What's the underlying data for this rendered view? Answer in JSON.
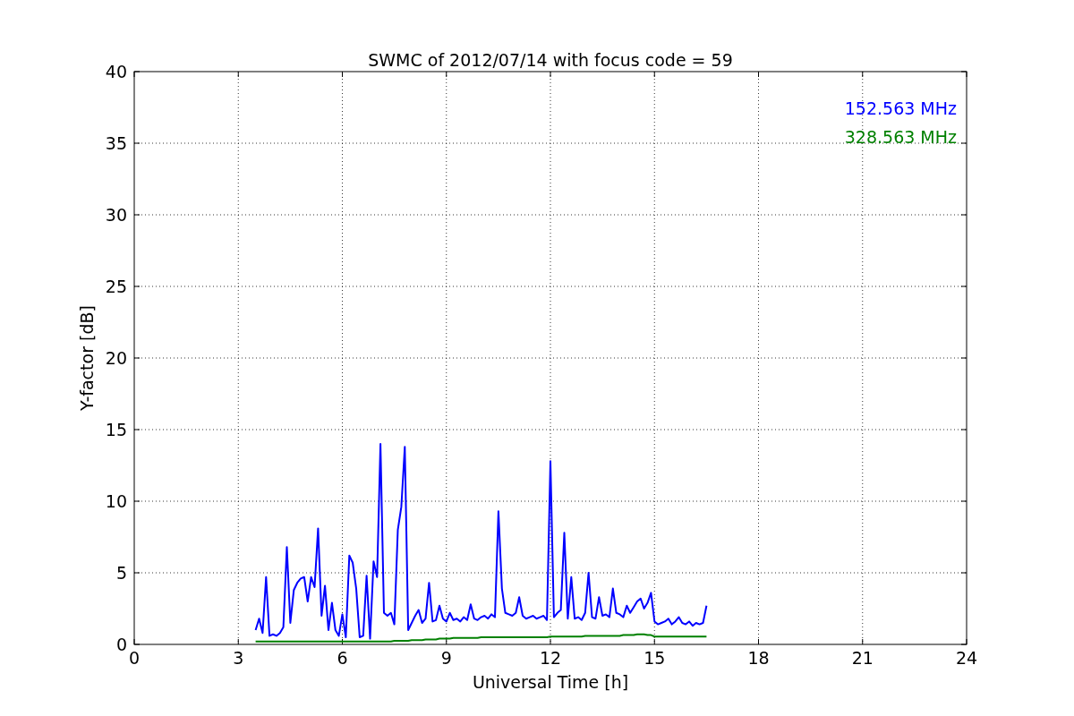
{
  "figure": {
    "chart_data": {
      "type": "line",
      "title": "SWMC of 2012/07/14 with focus code = 59",
      "xlabel": "Universal Time [h]",
      "ylabel": "Y-factor [dB]",
      "xlim": [
        0,
        24
      ],
      "ylim": [
        0,
        40
      ],
      "grid": true,
      "xticks": [
        0,
        3,
        6,
        9,
        12,
        15,
        18,
        21,
        24
      ],
      "yticks": [
        0,
        5,
        10,
        15,
        20,
        25,
        30,
        35,
        40
      ],
      "x": [
        3.5,
        3.6,
        3.7,
        3.8,
        3.9,
        4.0,
        4.1,
        4.2,
        4.3,
        4.4,
        4.5,
        4.6,
        4.7,
        4.8,
        4.9,
        5.0,
        5.1,
        5.2,
        5.3,
        5.4,
        5.5,
        5.6,
        5.7,
        5.8,
        5.9,
        6.0,
        6.1,
        6.2,
        6.3,
        6.4,
        6.5,
        6.6,
        6.7,
        6.8,
        6.9,
        7.0,
        7.1,
        7.2,
        7.3,
        7.4,
        7.5,
        7.6,
        7.7,
        7.8,
        7.9,
        8.0,
        8.1,
        8.2,
        8.3,
        8.4,
        8.5,
        8.6,
        8.7,
        8.8,
        8.9,
        9.0,
        9.1,
        9.2,
        9.3,
        9.4,
        9.5,
        9.6,
        9.7,
        9.8,
        9.9,
        10.0,
        10.1,
        10.2,
        10.3,
        10.4,
        10.5,
        10.6,
        10.7,
        10.8,
        10.9,
        11.0,
        11.1,
        11.2,
        11.3,
        11.4,
        11.5,
        11.6,
        11.7,
        11.8,
        11.9,
        12.0,
        12.1,
        12.2,
        12.3,
        12.4,
        12.5,
        12.6,
        12.7,
        12.8,
        12.9,
        13.0,
        13.1,
        13.2,
        13.3,
        13.4,
        13.5,
        13.6,
        13.7,
        13.8,
        13.9,
        14.0,
        14.1,
        14.2,
        14.3,
        14.4,
        14.5,
        14.6,
        14.7,
        14.8,
        14.9,
        15.0,
        15.1,
        15.2,
        15.3,
        15.4,
        15.5,
        15.6,
        15.7,
        15.8,
        15.9,
        16.0,
        16.1,
        16.2,
        16.3,
        16.4,
        16.5
      ],
      "series": [
        {
          "name": "152.563 MHz",
          "color": "#0000ff",
          "values": [
            1.0,
            1.8,
            0.8,
            4.7,
            0.6,
            0.7,
            0.6,
            0.8,
            1.2,
            6.8,
            1.5,
            3.8,
            4.3,
            4.6,
            4.7,
            3.0,
            4.7,
            4.0,
            8.1,
            2.0,
            4.1,
            1.0,
            2.9,
            1.0,
            0.6,
            2.1,
            0.5,
            6.2,
            5.7,
            3.9,
            0.5,
            0.6,
            4.8,
            0.4,
            5.8,
            4.7,
            14.0,
            2.2,
            2.0,
            2.2,
            1.4,
            8.0,
            9.6,
            13.8,
            1.0,
            1.5,
            2.0,
            2.4,
            1.5,
            1.8,
            4.3,
            1.6,
            1.7,
            2.7,
            1.8,
            1.6,
            2.2,
            1.7,
            1.8,
            1.6,
            1.9,
            1.7,
            2.8,
            1.8,
            1.7,
            1.9,
            2.0,
            1.8,
            2.1,
            1.9,
            9.3,
            3.9,
            2.2,
            2.1,
            2.0,
            2.2,
            3.3,
            2.0,
            1.8,
            1.9,
            2.0,
            1.8,
            1.9,
            2.0,
            1.7,
            12.8,
            1.9,
            2.2,
            2.4,
            7.8,
            1.8,
            4.7,
            1.8,
            1.9,
            1.7,
            2.2,
            5.0,
            1.9,
            1.8,
            3.3,
            2.0,
            2.1,
            1.9,
            3.9,
            2.2,
            2.1,
            1.9,
            2.7,
            2.2,
            2.6,
            3.0,
            3.2,
            2.5,
            2.9,
            3.6,
            1.6,
            1.4,
            1.5,
            1.6,
            1.8,
            1.4,
            1.6,
            1.9,
            1.5,
            1.4,
            1.6,
            1.3,
            1.5,
            1.4,
            1.5,
            2.7
          ]
        },
        {
          "name": "328.563 MHz",
          "color": "#008000",
          "values": [
            0.2,
            0.2,
            0.2,
            0.2,
            0.2,
            0.2,
            0.2,
            0.2,
            0.2,
            0.2,
            0.2,
            0.2,
            0.2,
            0.2,
            0.2,
            0.2,
            0.2,
            0.2,
            0.2,
            0.2,
            0.2,
            0.2,
            0.2,
            0.2,
            0.2,
            0.2,
            0.2,
            0.2,
            0.2,
            0.2,
            0.2,
            0.2,
            0.2,
            0.2,
            0.2,
            0.2,
            0.2,
            0.2,
            0.2,
            0.2,
            0.25,
            0.25,
            0.25,
            0.25,
            0.25,
            0.3,
            0.3,
            0.3,
            0.3,
            0.35,
            0.35,
            0.35,
            0.35,
            0.4,
            0.4,
            0.4,
            0.4,
            0.45,
            0.45,
            0.45,
            0.45,
            0.45,
            0.45,
            0.45,
            0.45,
            0.5,
            0.5,
            0.5,
            0.5,
            0.5,
            0.5,
            0.5,
            0.5,
            0.5,
            0.5,
            0.5,
            0.5,
            0.5,
            0.5,
            0.5,
            0.5,
            0.5,
            0.5,
            0.5,
            0.5,
            0.55,
            0.55,
            0.55,
            0.55,
            0.55,
            0.55,
            0.55,
            0.55,
            0.55,
            0.55,
            0.6,
            0.6,
            0.6,
            0.6,
            0.6,
            0.6,
            0.6,
            0.6,
            0.6,
            0.6,
            0.6,
            0.65,
            0.65,
            0.65,
            0.65,
            0.7,
            0.7,
            0.7,
            0.65,
            0.65,
            0.55,
            0.55,
            0.55,
            0.55,
            0.55,
            0.55,
            0.55,
            0.55,
            0.55,
            0.55,
            0.55,
            0.55,
            0.55,
            0.55,
            0.55,
            0.55
          ]
        }
      ]
    }
  }
}
